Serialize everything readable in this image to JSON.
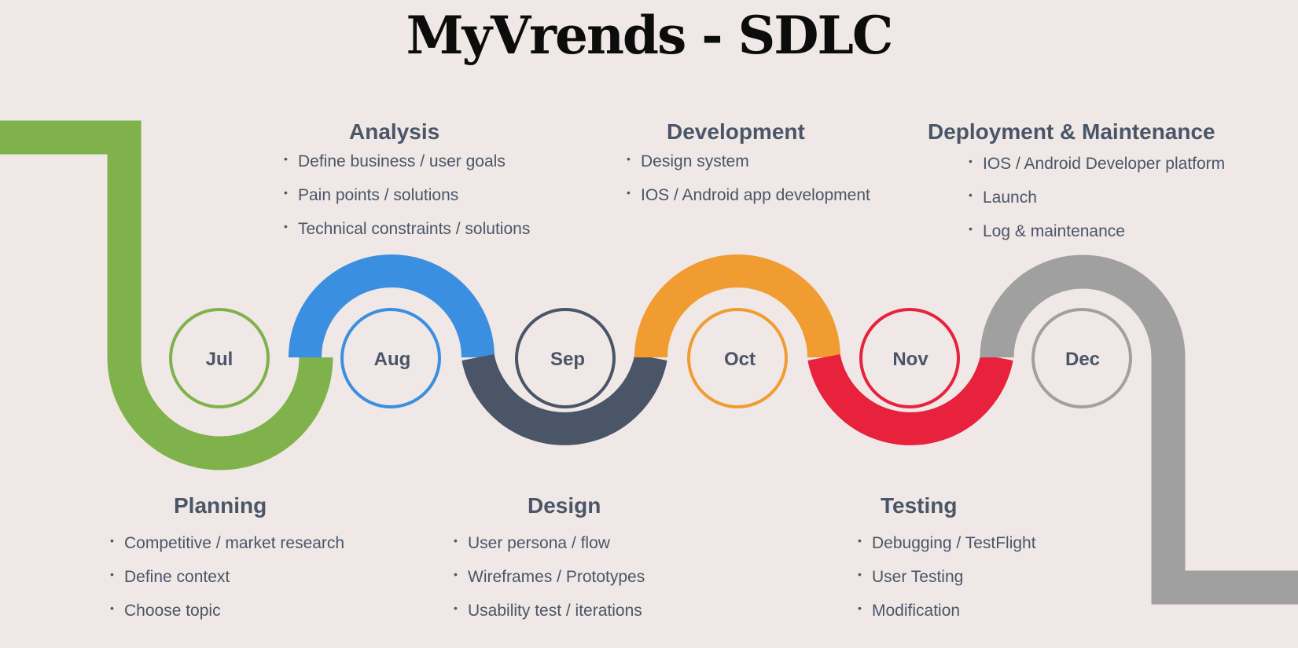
{
  "title": "MyVrends - SDLC",
  "months": [
    {
      "label": "Jul",
      "color": "#7fb24a"
    },
    {
      "label": "Aug",
      "color": "#3a8fe0"
    },
    {
      "label": "Sep",
      "color": "#4a5568"
    },
    {
      "label": "Oct",
      "color": "#f09c30"
    },
    {
      "label": "Nov",
      "color": "#e8213c"
    },
    {
      "label": "Dec",
      "color": "#a0a0a0"
    }
  ],
  "phases": {
    "planning": {
      "title": "Planning",
      "items": [
        "Competitive / market research",
        "Define context",
        "Choose topic"
      ]
    },
    "analysis": {
      "title": "Analysis",
      "items": [
        "Define business / user goals",
        "Pain points / solutions",
        "Technical constraints / solutions"
      ]
    },
    "design": {
      "title": "Design",
      "items": [
        "User persona / flow",
        "Wireframes / Prototypes",
        "Usability test / iterations"
      ]
    },
    "development": {
      "title": "Development",
      "items": [
        "Design system",
        "IOS / Android app development"
      ]
    },
    "testing": {
      "title": "Testing",
      "items": [
        "Debugging / TestFlight",
        "User Testing",
        "Modification"
      ]
    },
    "deployment": {
      "title": "Deployment & Maintenance",
      "items": [
        "IOS / Android Developer platform",
        "Launch",
        "Log & maintenance"
      ]
    }
  }
}
